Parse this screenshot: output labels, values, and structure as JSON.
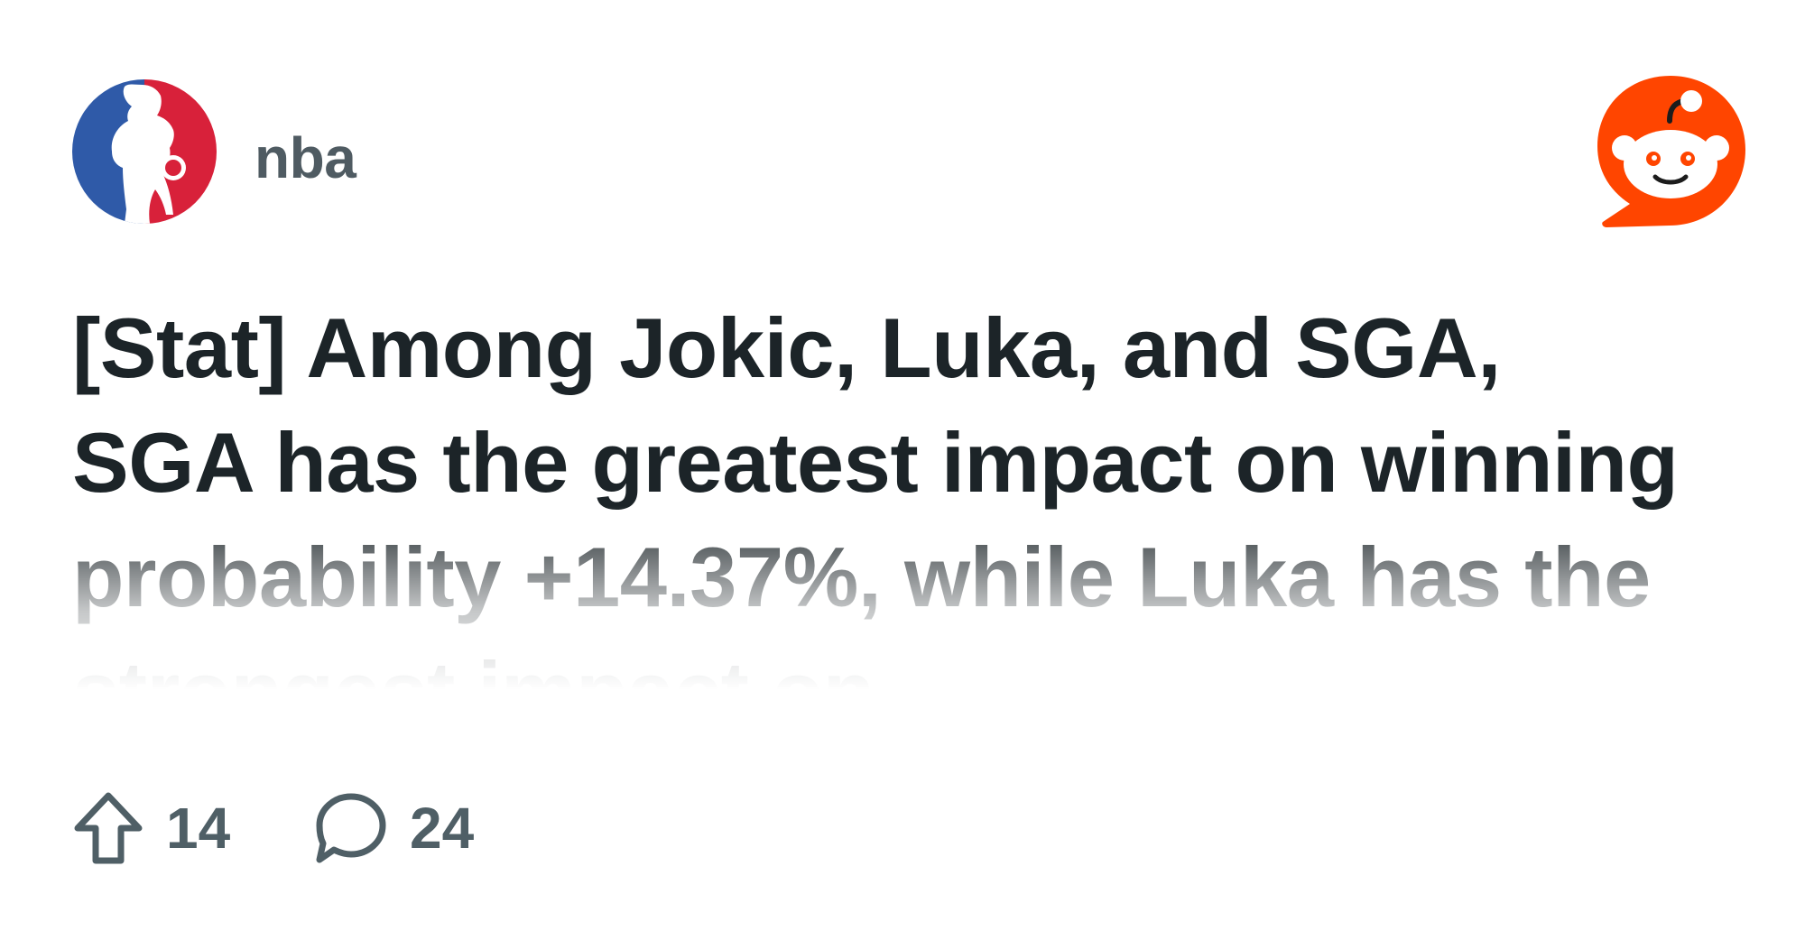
{
  "subreddit": {
    "name": "nba",
    "avatar_icon": "nba-logo-icon",
    "colors": {
      "blue": "#2f5aa8",
      "red": "#d8213a"
    }
  },
  "brand": {
    "icon": "reddit-snoo-icon",
    "color": "#ff4500"
  },
  "post": {
    "title": "[Stat] Among Jokic, Luka, and SGA, SGA has the greatest impact on winning probability +14.37%, while Luka has the strongest impact on"
  },
  "actions": {
    "upvote_icon": "upvote-arrow-icon",
    "upvotes": "14",
    "comment_icon": "comment-bubble-icon",
    "comments": "24"
  },
  "colors": {
    "title": "#1c2428",
    "meta": "#4f5f66"
  }
}
